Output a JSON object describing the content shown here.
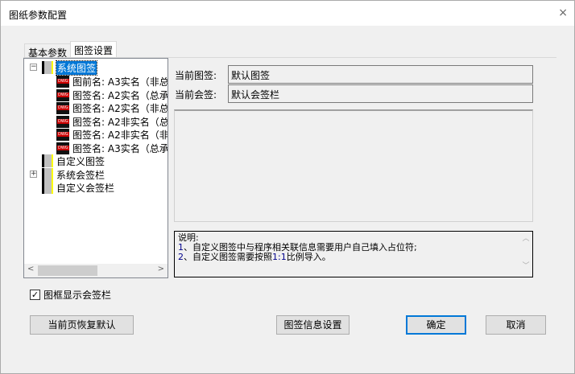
{
  "window": {
    "title": "图纸参数配置",
    "close": "×"
  },
  "tabs": [
    {
      "label": "基本参数",
      "selected": false
    },
    {
      "label": "图签设置",
      "selected": true
    }
  ],
  "tree": {
    "root": {
      "label": "系统图签",
      "children": [
        "图前名: A3实名（非总",
        "图签名: A2实名（总承",
        "图签名: A2实名（非总",
        "图签名: A2非实名（总",
        "图签名: A2非实名（非",
        "图签名: A3实名（总承"
      ]
    },
    "others": [
      "自定义图签",
      "系统会签栏",
      "自定义会签栏"
    ]
  },
  "current": {
    "title_label": "当前图签:",
    "title_value": "默认图签",
    "sign_label": "当前会签:",
    "sign_value": "默认会签栏"
  },
  "description": {
    "heading": "说明:",
    "line1_num": "1",
    "line1": "、自定义图签中与程序相关联信息需要用户自己填入占位符;",
    "line2_num": "2",
    "line2_a": "、自定义图签需要按照",
    "line2_ratio": "1:1",
    "line2_b": "比例导入。"
  },
  "checkbox": {
    "label": "图框显示会签栏",
    "checked": true,
    "mark": "✓"
  },
  "buttons": {
    "restore": "当前页恢复默认",
    "info": "图签信息设置",
    "ok": "确定",
    "cancel": "取消"
  }
}
